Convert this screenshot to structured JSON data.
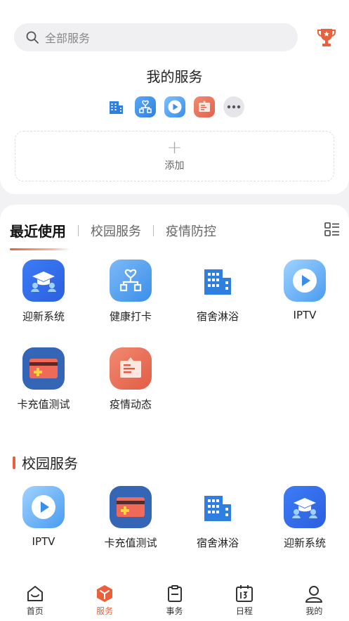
{
  "search": {
    "placeholder": "全部服务",
    "icon": "search-icon"
  },
  "header": {
    "trophy_icon": "trophy-icon"
  },
  "my_services": {
    "title": "我的服务",
    "pinned_icons": [
      "building-icon",
      "health-checkin-icon",
      "play-icon",
      "notice-card-icon",
      "more-icon"
    ],
    "add_label": "添加"
  },
  "tabs": [
    {
      "label": "最近使用",
      "active": true
    },
    {
      "label": "校园服务",
      "active": false
    },
    {
      "label": "疫情防控",
      "active": false
    }
  ],
  "recent_apps": [
    {
      "label": "迎新系统",
      "icon": "graduation-cap-icon"
    },
    {
      "label": "健康打卡",
      "icon": "health-checkin-icon"
    },
    {
      "label": "宿舍淋浴",
      "icon": "building-icon"
    },
    {
      "label": "IPTV",
      "icon": "play-icon"
    },
    {
      "label": "卡充值测试",
      "icon": "card-recharge-icon"
    },
    {
      "label": "疫情动态",
      "icon": "notice-card-icon"
    }
  ],
  "campus_section": {
    "title": "校园服务",
    "apps": [
      {
        "label": "IPTV",
        "icon": "play-icon"
      },
      {
        "label": "卡充值测试",
        "icon": "card-recharge-icon"
      },
      {
        "label": "宿舍淋浴",
        "icon": "building-icon"
      },
      {
        "label": "迎新系统",
        "icon": "graduation-cap-icon"
      }
    ]
  },
  "bottom_nav": [
    {
      "label": "首页",
      "icon": "home-icon",
      "active": false
    },
    {
      "label": "服务",
      "icon": "service-cube-icon",
      "active": true
    },
    {
      "label": "事务",
      "icon": "clipboard-icon",
      "active": false
    },
    {
      "label": "日程",
      "icon": "calendar-icon",
      "active": false
    },
    {
      "label": "我的",
      "icon": "user-icon",
      "active": false
    }
  ],
  "colors": {
    "accent": "#e8603c",
    "blue": "#3a8ee8",
    "red": "#e8604c"
  }
}
